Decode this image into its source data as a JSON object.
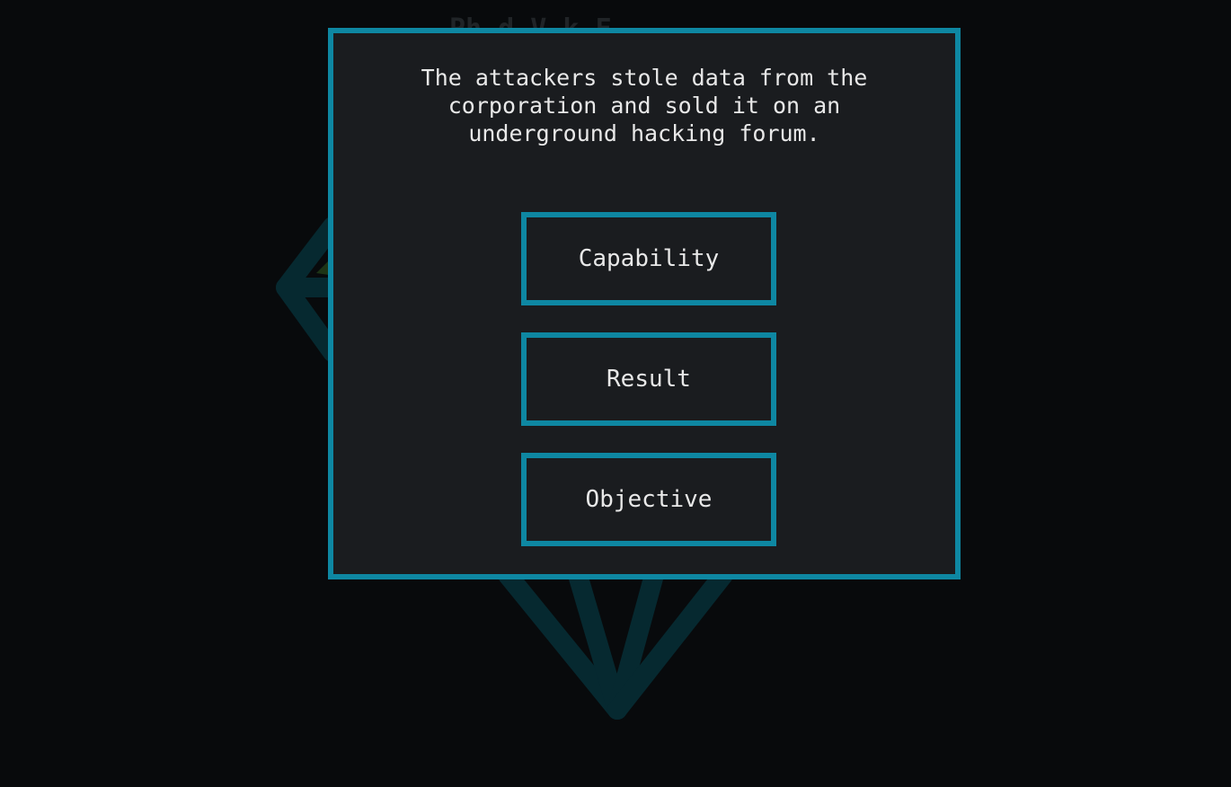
{
  "game": {
    "diamond_color": "#062930",
    "accent_color": "#0e87a2",
    "panel_color": "#1a1c1f",
    "background_color": "#080a0c"
  },
  "dialog": {
    "question": "The attackers stole data from the\ncorporation and sold it on an\nunderground hacking forum.",
    "answers": [
      {
        "label": "Capability"
      },
      {
        "label": "Result"
      },
      {
        "label": "Objective"
      }
    ]
  }
}
